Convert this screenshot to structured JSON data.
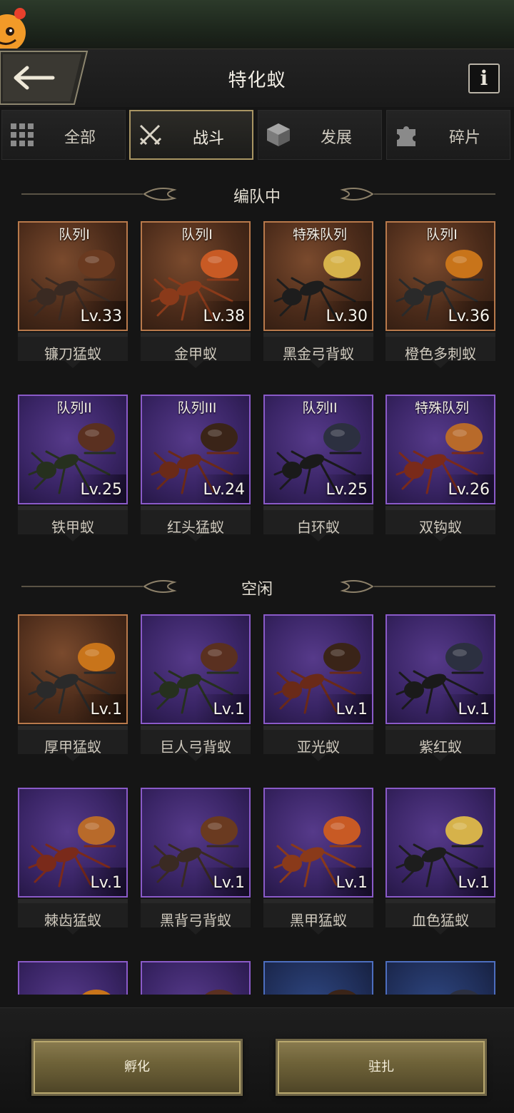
{
  "header": {
    "title": "特化蚁",
    "info_label": "i"
  },
  "tabs": [
    {
      "label": "全部",
      "icon": "grid-icon"
    },
    {
      "label": "战斗",
      "icon": "crossed-swords-icon"
    },
    {
      "label": "发展",
      "icon": "cube-icon"
    },
    {
      "label": "碎片",
      "icon": "puzzle-piece-icon"
    }
  ],
  "active_tab": "战斗",
  "sections": {
    "in_team": "编队中",
    "idle": "空闲"
  },
  "team_ants": [
    {
      "name": "镰刀猛蚁",
      "queue": "队列I",
      "level": "Lv.33",
      "rarity": "orange"
    },
    {
      "name": "金甲蚁",
      "queue": "队列I",
      "level": "Lv.38",
      "rarity": "orange"
    },
    {
      "name": "黑金弓背蚁",
      "queue": "特殊队列",
      "level": "Lv.30",
      "rarity": "orange"
    },
    {
      "name": "橙色多刺蚁",
      "queue": "队列I",
      "level": "Lv.36",
      "rarity": "orange"
    },
    {
      "name": "铁甲蚁",
      "queue": "队列II",
      "level": "Lv.25",
      "rarity": "purple"
    },
    {
      "name": "红头猛蚁",
      "queue": "队列III",
      "level": "Lv.24",
      "rarity": "purple"
    },
    {
      "name": "白环蚁",
      "queue": "队列II",
      "level": "Lv.25",
      "rarity": "purple"
    },
    {
      "name": "双钩蚁",
      "queue": "特殊队列",
      "level": "Lv.26",
      "rarity": "purple"
    }
  ],
  "idle_ants": [
    {
      "name": "厚甲猛蚁",
      "level": "Lv.1",
      "rarity": "orange"
    },
    {
      "name": "巨人弓背蚁",
      "level": "Lv.1",
      "rarity": "purple"
    },
    {
      "name": "亚光蚁",
      "level": "Lv.1",
      "rarity": "purple"
    },
    {
      "name": "紫红蚁",
      "level": "Lv.1",
      "rarity": "purple"
    },
    {
      "name": "棘齿猛蚁",
      "level": "Lv.1",
      "rarity": "purple"
    },
    {
      "name": "黑背弓背蚁",
      "level": "Lv.1",
      "rarity": "purple"
    },
    {
      "name": "黑甲猛蚁",
      "level": "Lv.1",
      "rarity": "purple"
    },
    {
      "name": "血色猛蚁",
      "level": "Lv.1",
      "rarity": "purple"
    },
    {
      "name": "",
      "level": "",
      "rarity": "purple"
    },
    {
      "name": "",
      "level": "",
      "rarity": "purple"
    },
    {
      "name": "",
      "level": "",
      "rarity": "blue"
    },
    {
      "name": "",
      "level": "",
      "rarity": "blue"
    }
  ],
  "buttons": {
    "hatch": "孵化",
    "station": "驻扎"
  },
  "colors": {
    "gold_accent": "#a99563",
    "rarity_orange": "#b8794b",
    "rarity_purple": "#8a5ac8",
    "rarity_blue": "#4d6ebf"
  }
}
